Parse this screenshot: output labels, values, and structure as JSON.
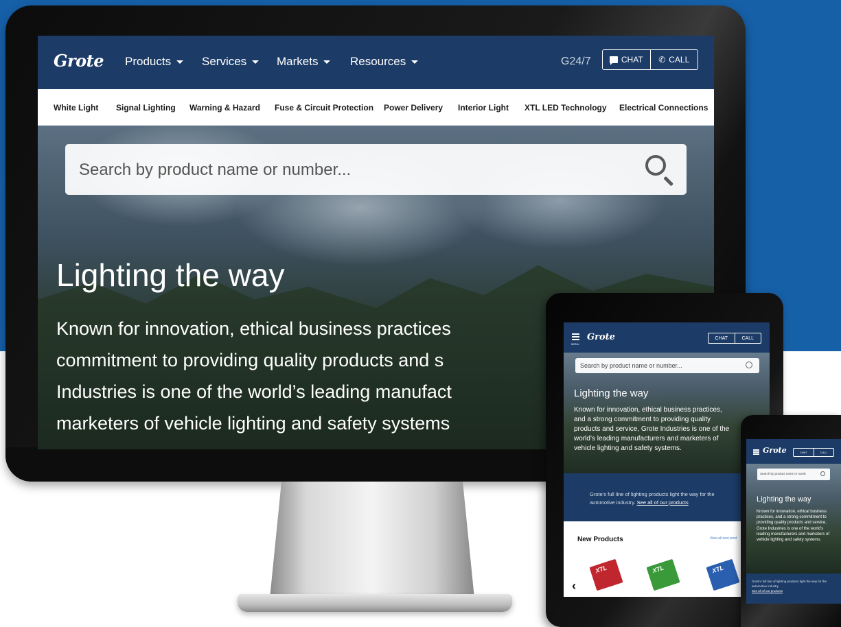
{
  "colors": {
    "banner": "#1660a8",
    "nav": "#1c3b66",
    "white": "#ffffff"
  },
  "desktop": {
    "logo": "Grote",
    "menu": [
      "Products",
      "Services",
      "Markets",
      "Resources"
    ],
    "g247": "G24/7",
    "chat_label": "CHAT",
    "call_label": "CALL",
    "categories": [
      "White Light",
      "Signal Lighting",
      "Warning & Hazard",
      "Fuse & Circuit Protection",
      "Power Delivery",
      "Interior Light",
      "XTL LED Technology",
      "Electrical Connections"
    ],
    "search_placeholder": "Search by product name or number...",
    "hero_title": "Lighting the way",
    "hero_text": "Known for innovation, ethical business practices\ncommitment to providing quality products and s\nIndustries is one of the world’s leading manufact\nmarketers of vehicle lighting and safety systems"
  },
  "tablet": {
    "menu_label": "MENU",
    "logo": "Grote",
    "chat_label": "CHAT",
    "call_label": "CALL",
    "search_placeholder": "Search by product name or number...",
    "hero_title": "Lighting the way",
    "hero_text": "Known for innovation, ethical business practices, and a strong commitment to providing quality products and service, Grote Industries is one of the world’s leading manufacturers and marketers of vehicle lighting and safety systems.",
    "band_text": "Grote’s full line of lighting products light the way for the automotive industry.",
    "band_link": "See all of our products",
    "new_products": "New Products",
    "view_all": "View all new prod",
    "product_badge": "XTL"
  },
  "phone": {
    "logo": "Grote",
    "chat_label": "CHAT",
    "call_label": "CALL",
    "search_placeholder": "Search by product name or numb",
    "hero_title": "Lighting the way",
    "hero_text": "Known for innovation, ethical business practices, and a strong commitment to providing quality products and service, Grote Industries is one of the world’s leading manufacturers and marketers of vehicle lighting and safety systems.",
    "band_text": "Grote’s full line of lighting products light the way for the automotive industry.",
    "band_link": "See all of our products"
  }
}
